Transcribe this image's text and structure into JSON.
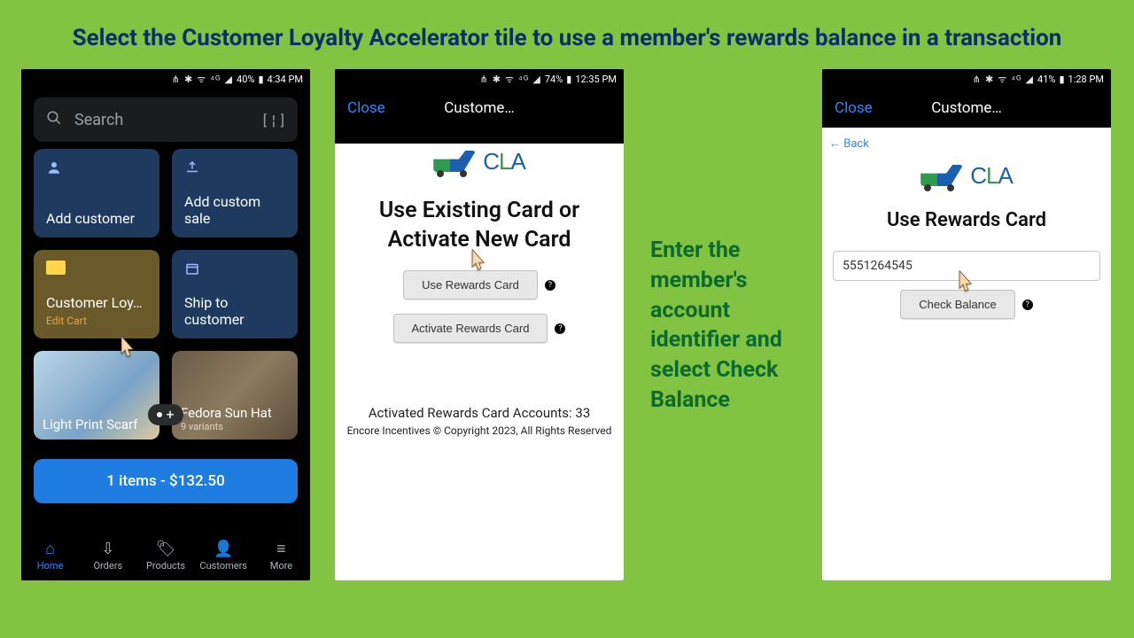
{
  "page_title": "Select the Customer Loyalty Accelerator tile to use a member's rewards balance in a transaction",
  "annotation": "Enter the member's account identifier and select Check Balance",
  "phone1": {
    "status": {
      "icons": "⋔ ✱ ᯤ ⁴ᴳ ◢",
      "battery": "40%",
      "time": "4:34 PM"
    },
    "search_placeholder": "Search",
    "tiles": {
      "add_customer": "Add customer",
      "add_custom_sale": "Add custom sale",
      "cla": "Customer Loy…",
      "cla_sub": "Edit Cart",
      "ship": "Ship to customer"
    },
    "products": {
      "scarf": "Light Print Scarf",
      "fedora": "Fedora Sun Hat",
      "fedora_sub": "9 variants"
    },
    "cart_button": "1 items - $132.50",
    "tabs": {
      "home": "Home",
      "orders": "Orders",
      "products": "Products",
      "customers": "Customers",
      "more": "More"
    }
  },
  "phone2": {
    "status": {
      "icons": "⋔ ✱ ᯤ ⁴ᴳ ◢",
      "battery": "74%",
      "time": "12:35 PM"
    },
    "close": "Close",
    "nav_title": "Custome…",
    "logo_text": {
      "c": "C",
      "l": "L",
      "a": "A"
    },
    "heading": "Use Existing Card or Activate New Card",
    "use_btn": "Use Rewards Card",
    "activate_btn": "Activate Rewards Card",
    "activated_count": "Activated Rewards Card Accounts: 33",
    "copyright": "Encore Incentives © Copyright 2023, All Rights Reserved"
  },
  "phone3": {
    "status": {
      "icons": "⋔ ✱ ᯤ ⁴ᴳ ◢",
      "battery": "41%",
      "time": "1:28 PM"
    },
    "close": "Close",
    "nav_title": "Custome…",
    "back": "← Back",
    "logo_text": {
      "c": "C",
      "l": "L",
      "a": "A"
    },
    "heading": "Use Rewards Card",
    "account_value": "5551264545",
    "check_btn": "Check Balance"
  }
}
